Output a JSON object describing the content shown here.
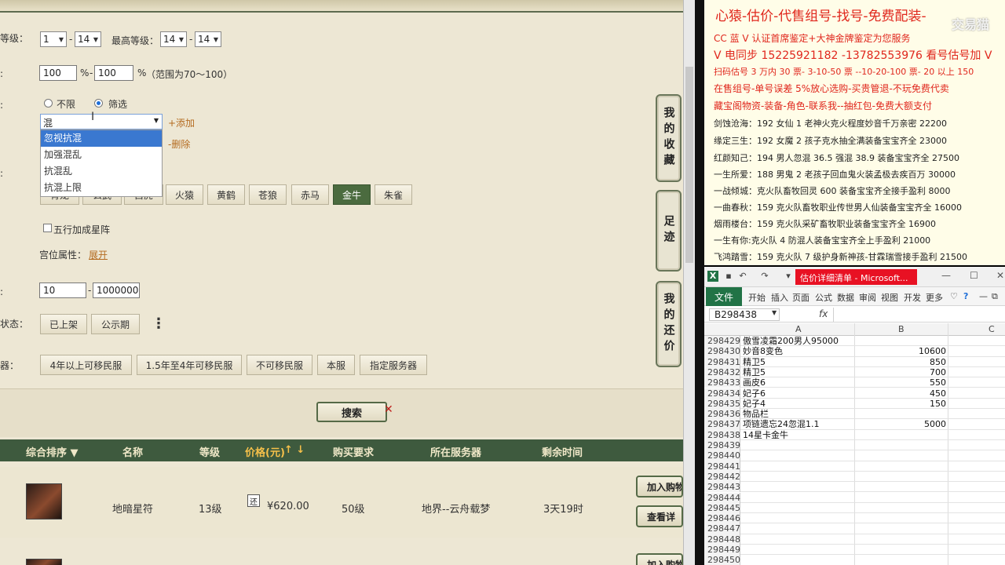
{
  "filters": {
    "level_label": "等级：",
    "level_from": "1",
    "level_to": "14",
    "max_level_label": "最高等级：",
    "max_level_from": "14",
    "max_level_to": "14",
    "pct_from": "100",
    "pct_to": "100",
    "pct_sign": "%",
    "range_hint": "（范围为70～100）",
    "radio_unlimited": "不限",
    "radio_filter": "筛选",
    "attr_input": "混",
    "add_link": "+添加",
    "delete_link": "-删除",
    "dropdown_options": [
      "忽视抗混",
      "加强混乱",
      "抗混乱",
      "抗混上限"
    ],
    "beast_buttons": [
      "青龙",
      "玄武",
      "白虎",
      "火猿",
      "黄鹤",
      "苍狼",
      "赤马",
      "金牛",
      "朱雀"
    ],
    "wuxing_checkbox": "五行加成星阵",
    "palace_label": "宫位属性：",
    "palace_link": "展开",
    "price_from": "10",
    "price_to": "1000000",
    "status_label": "状态：",
    "status_buttons": [
      "已上架",
      "公示期"
    ],
    "more_icon": "⋮",
    "server_label": "器：",
    "server_buttons": [
      "4年以上可移民服",
      "1.5年至4年可移民服",
      "不可移民服",
      "本服",
      "指定服务器"
    ],
    "search_button": "搜索"
  },
  "side_tabs": [
    "我的收藏",
    "足迹",
    "我的还价"
  ],
  "table": {
    "headers": [
      "综合排序 ▼",
      "名称",
      "等级",
      "价格(元)",
      "购买要求",
      "所在服务器",
      "剩余时间"
    ],
    "price_sort": "↑ ↓",
    "rows": [
      {
        "name": "地暗星符",
        "level": "13级",
        "price": "¥620.00",
        "req": "50级",
        "server": "地界--云舟载梦",
        "time": "3天19时"
      }
    ],
    "add_cart": "加入购物",
    "view_detail": "查看详",
    "add_cart_2": "加入购物",
    "price_icon": "还"
  },
  "notes": {
    "title": "心猿-估价-代售组号-找号-免费配装-",
    "watermark": "交易猫",
    "lines": [
      {
        "text": "CC 蓝 V 认证首席鉴定+大神金牌鉴定为您服务",
        "color": "red"
      },
      {
        "text": "V 电同步 15225921182 -13782553976 看号估号加 V",
        "color": "red",
        "big": true
      },
      {
        "text": "扫码估号 3 万内 30 票- 3-10-50 票 --10-20-100 票- 20 以上 150",
        "color": "red"
      },
      {
        "text": "在售组号-单号误差 5%放心选购-买贵管退-不玩免费代卖",
        "color": "red"
      },
      {
        "text": "藏宝阁物资-装备-角色-联系我--抽红包-免费大额支付",
        "color": "red"
      },
      {
        "text": "剑蚀沧海：192 女仙 1 老神火克火程度妙音千万亲密 22200",
        "color": "black"
      },
      {
        "text": "缘定三生：192 女魔 2 孩子克水抽全满装备宝宝齐全 23000",
        "color": "black"
      },
      {
        "text": "红颜知己：194 男人忽混 36.5 强混 38.9 装备宝宝齐全 27500",
        "color": "black"
      },
      {
        "text": "一生所爱：188 男鬼 2 老孩子回血鬼火装孟极去疾百万 30000",
        "color": "black"
      },
      {
        "text": "一战倾城：克火队畜牧回灵 600 装备宝宝齐全接手盈利 8000",
        "color": "black"
      },
      {
        "text": "一曲春秋：159 克火队畜牧职业传世男人仙装备宝宝齐全 16000",
        "color": "black"
      },
      {
        "text": "烟雨楼台：159 克火队采矿畜牧职业装备宝宝齐全 16900",
        "color": "black"
      },
      {
        "text": "一生有你:克火队 4 防混人装备宝宝齐全上手盈利 21000",
        "color": "black"
      },
      {
        "text": "飞鸿踏雪：159 克火队 7 级护身新神孩-甘霖瑞雪接手盈利 21500",
        "color": "black"
      }
    ]
  },
  "excel": {
    "window_title": "估价详细清单 - Microsoft...",
    "file_tab": "文件",
    "ribbon_tabs": [
      "开始",
      "插入",
      "页面",
      "公式",
      "数据",
      "审阅",
      "视图",
      "开发",
      "更多"
    ],
    "name_box": "B298438",
    "fx": "fx",
    "columns": [
      "A",
      "B",
      "C"
    ],
    "rows": [
      {
        "n": "298429",
        "a": "傲雪凌霜200男人95000",
        "b": ""
      },
      {
        "n": "298430",
        "a": "妙音8变色",
        "b": "10600"
      },
      {
        "n": "298431",
        "a": "精卫5",
        "b": "850"
      },
      {
        "n": "298432",
        "a": "精卫5",
        "b": "700"
      },
      {
        "n": "298433",
        "a": "画皮6",
        "b": "550"
      },
      {
        "n": "298434",
        "a": "妃子6",
        "b": "450"
      },
      {
        "n": "298435",
        "a": "妃子4",
        "b": "150"
      },
      {
        "n": "298436",
        "a": "物品栏",
        "b": ""
      },
      {
        "n": "298437",
        "a": "项链遗忘24忽混1.1",
        "b": "5000"
      },
      {
        "n": "298438",
        "a": "14星卡金牛",
        "b": ""
      },
      {
        "n": "298439",
        "a": "",
        "b": ""
      },
      {
        "n": "298440",
        "a": "",
        "b": ""
      },
      {
        "n": "298441",
        "a": "",
        "b": ""
      },
      {
        "n": "298442",
        "a": "",
        "b": ""
      },
      {
        "n": "298443",
        "a": "",
        "b": ""
      },
      {
        "n": "298444",
        "a": "",
        "b": ""
      },
      {
        "n": "298445",
        "a": "",
        "b": ""
      },
      {
        "n": "298446",
        "a": "",
        "b": ""
      },
      {
        "n": "298447",
        "a": "",
        "b": ""
      },
      {
        "n": "298448",
        "a": "",
        "b": ""
      },
      {
        "n": "298449",
        "a": "",
        "b": ""
      },
      {
        "n": "298450",
        "a": "",
        "b": ""
      }
    ]
  },
  "colors": {
    "accent_green": "#4b6b3f",
    "header_green": "#3e5a3e",
    "note_red": "#e0271d",
    "excel_green": "#217346",
    "link_orange": "#b46b20"
  }
}
